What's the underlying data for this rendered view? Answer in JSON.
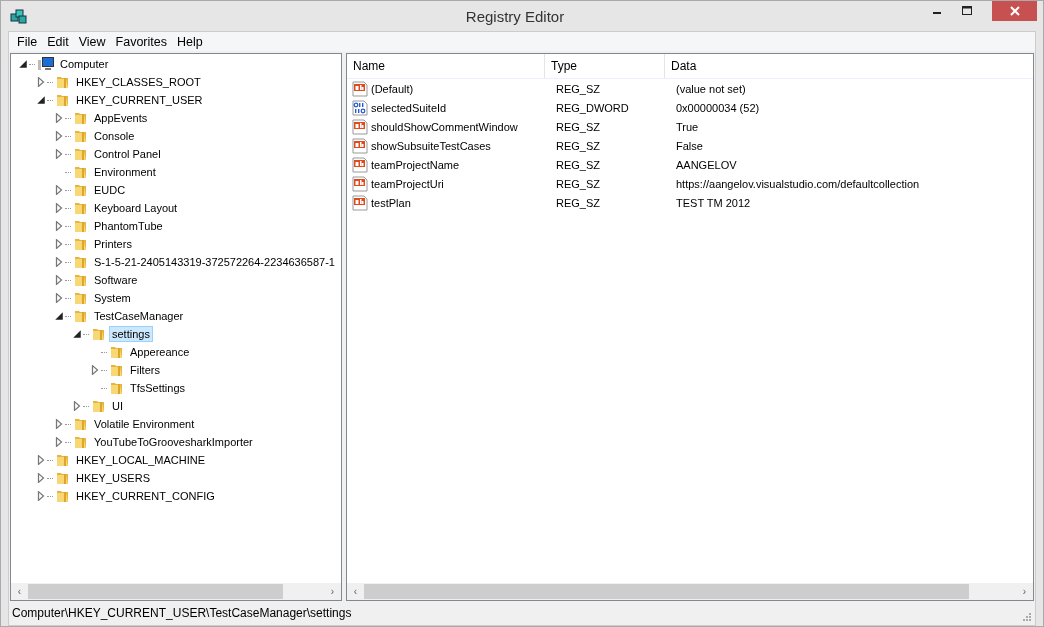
{
  "window": {
    "title": "Registry Editor"
  },
  "menu": [
    "File",
    "Edit",
    "View",
    "Favorites",
    "Help"
  ],
  "tree": [
    {
      "label": "Computer",
      "kind": "computer",
      "expanded": true,
      "selected": false,
      "children": [
        {
          "label": "HKEY_CLASSES_ROOT",
          "kind": "folder",
          "expanded": false,
          "selected": false
        },
        {
          "label": "HKEY_CURRENT_USER",
          "kind": "folder",
          "expanded": true,
          "selected": false,
          "children": [
            {
              "label": "AppEvents",
              "kind": "folder",
              "expanded": false,
              "selected": false
            },
            {
              "label": "Console",
              "kind": "folder",
              "expanded": false,
              "selected": false
            },
            {
              "label": "Control Panel",
              "kind": "folder",
              "expanded": false,
              "selected": false
            },
            {
              "label": "Environment",
              "kind": "folder",
              "selected": false
            },
            {
              "label": "EUDC",
              "kind": "folder",
              "expanded": false,
              "selected": false
            },
            {
              "label": "Keyboard Layout",
              "kind": "folder",
              "expanded": false,
              "selected": false
            },
            {
              "label": "PhantomTube",
              "kind": "folder",
              "expanded": false,
              "selected": false
            },
            {
              "label": "Printers",
              "kind": "folder",
              "expanded": false,
              "selected": false
            },
            {
              "label": "S-1-5-21-2405143319-372572264-2234636587-1",
              "kind": "folder",
              "expanded": false,
              "selected": false
            },
            {
              "label": "Software",
              "kind": "folder",
              "expanded": false,
              "selected": false
            },
            {
              "label": "System",
              "kind": "folder",
              "expanded": false,
              "selected": false
            },
            {
              "label": "TestCaseManager",
              "kind": "folder",
              "expanded": true,
              "selected": false,
              "children": [
                {
                  "label": "settings",
                  "kind": "folder",
                  "expanded": true,
                  "selected": true,
                  "children": [
                    {
                      "label": "Appereance",
                      "kind": "folder",
                      "selected": false
                    },
                    {
                      "label": "Filters",
                      "kind": "folder",
                      "expanded": false,
                      "selected": false
                    },
                    {
                      "label": "TfsSettings",
                      "kind": "folder",
                      "selected": false
                    }
                  ]
                },
                {
                  "label": "UI",
                  "kind": "folder",
                  "expanded": false,
                  "selected": false
                }
              ]
            },
            {
              "label": "Volatile Environment",
              "kind": "folder",
              "expanded": false,
              "selected": false
            },
            {
              "label": "YouTubeToGroovesharkImporter",
              "kind": "folder",
              "expanded": false,
              "selected": false
            }
          ]
        },
        {
          "label": "HKEY_LOCAL_MACHINE",
          "kind": "folder",
          "expanded": false,
          "selected": false
        },
        {
          "label": "HKEY_USERS",
          "kind": "folder",
          "expanded": false,
          "selected": false
        },
        {
          "label": "HKEY_CURRENT_CONFIG",
          "kind": "folder",
          "expanded": false,
          "selected": false
        }
      ]
    }
  ],
  "values": {
    "columns": [
      "Name",
      "Type",
      "Data"
    ],
    "rows": [
      {
        "kind": "string",
        "name": "(Default)",
        "type": "REG_SZ",
        "data": "(value not set)"
      },
      {
        "kind": "dword",
        "name": "selectedSuiteId",
        "type": "REG_DWORD",
        "data": "0x00000034 (52)"
      },
      {
        "kind": "string",
        "name": "shouldShowCommentWindow",
        "type": "REG_SZ",
        "data": "True"
      },
      {
        "kind": "string",
        "name": "showSubsuiteTestCases",
        "type": "REG_SZ",
        "data": "False"
      },
      {
        "kind": "string",
        "name": "teamProjectName",
        "type": "REG_SZ",
        "data": "AANGELOV"
      },
      {
        "kind": "string",
        "name": "teamProjectUri",
        "type": "REG_SZ",
        "data": "https://aangelov.visualstudio.com/defaultcollection"
      },
      {
        "kind": "string",
        "name": "testPlan",
        "type": "REG_SZ",
        "data": "TEST TM 2012"
      }
    ]
  },
  "scroll_arrows": [
    "‹",
    "›"
  ],
  "status_bar": "Computer\\HKEY_CURRENT_USER\\TestCaseManager\\settings"
}
